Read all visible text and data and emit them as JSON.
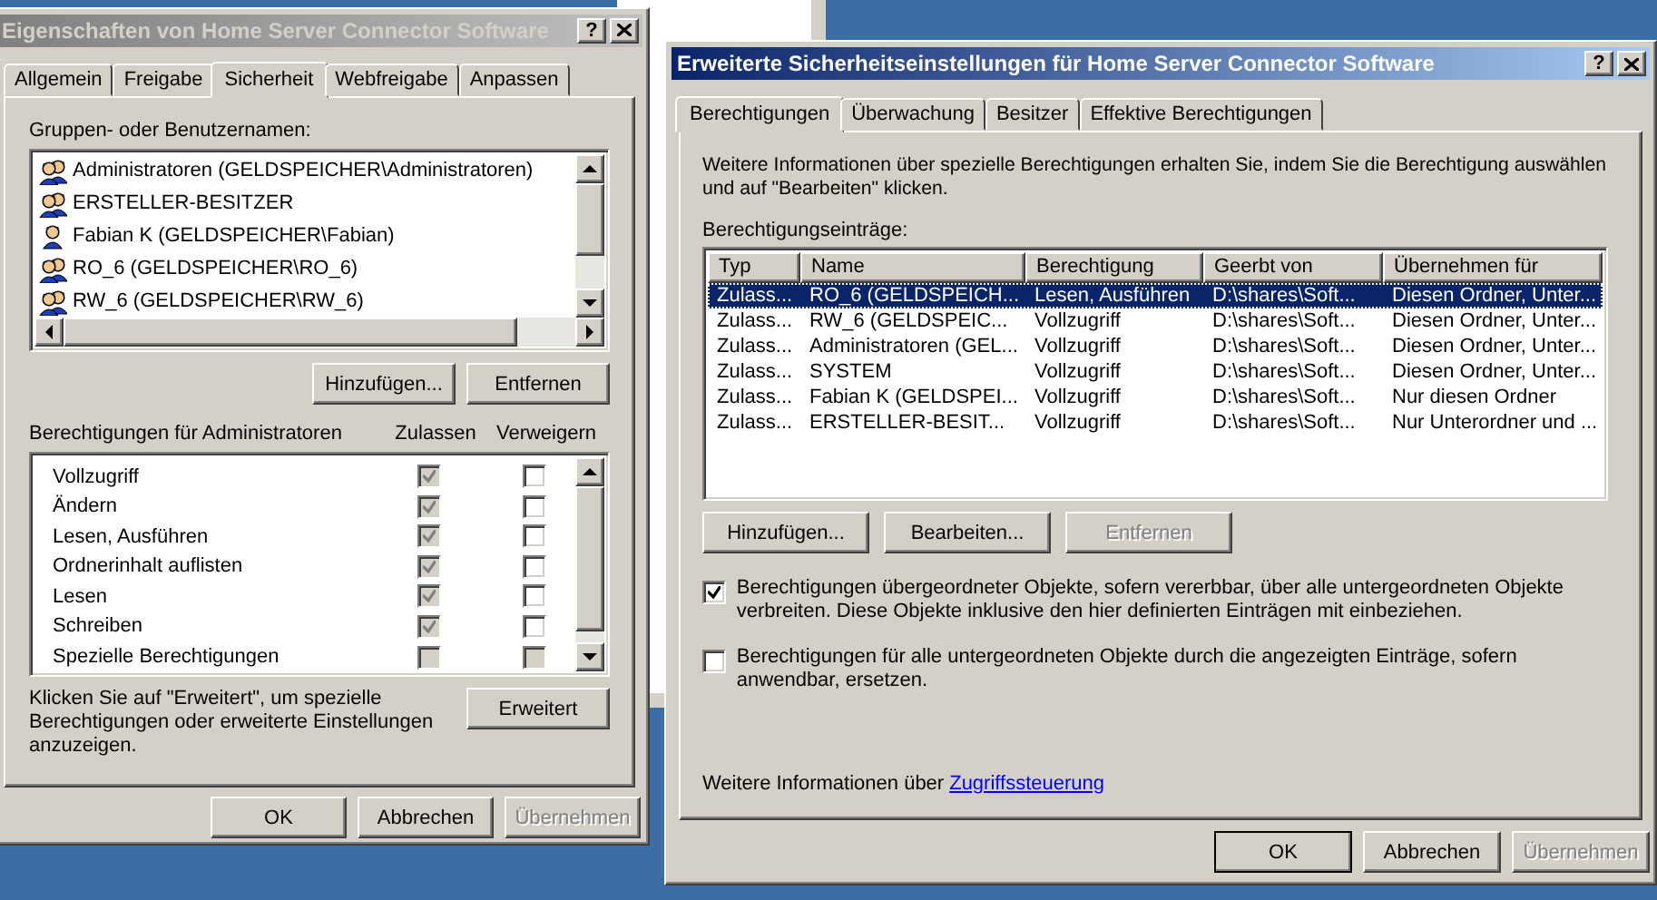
{
  "properties_dialog": {
    "title": "Eigenschaften von Home Server Connector Software",
    "active": false,
    "title_buttons": [
      "?"
    ],
    "tabs": [
      {
        "label": "Allgemein",
        "selected": false
      },
      {
        "label": "Freigabe",
        "selected": false
      },
      {
        "label": "Sicherheit",
        "selected": true
      },
      {
        "label": "Webfreigabe",
        "selected": false
      },
      {
        "label": "Anpassen",
        "selected": false
      }
    ],
    "groups_label": "Gruppen- oder Benutzernamen:",
    "groups": [
      {
        "name": "Administratoren (GELDSPEICHER\\Administratoren)",
        "kind": "group"
      },
      {
        "name": "ERSTELLER-BESITZER",
        "kind": "group"
      },
      {
        "name": "Fabian K (GELDSPEICHER\\Fabian)",
        "kind": "user"
      },
      {
        "name": "RO_6 (GELDSPEICHER\\RO_6)",
        "kind": "group"
      },
      {
        "name": "RW_6 (GELDSPEICHER\\RW_6)",
        "kind": "group"
      }
    ],
    "group_buttons": [
      {
        "label": "Hinzufügen...",
        "disabled": false
      },
      {
        "label": "Entfernen",
        "disabled": false
      }
    ],
    "permissions_label": "Berechtigungen für Administratoren",
    "permission_columns": [
      "Zulassen",
      "Verweigern"
    ],
    "permissions": [
      {
        "name": "Vollzugriff",
        "allow": {
          "checked": true,
          "disabled": true
        },
        "deny": {
          "checked": false,
          "disabled": false
        }
      },
      {
        "name": "Ändern",
        "allow": {
          "checked": true,
          "disabled": true
        },
        "deny": {
          "checked": false,
          "disabled": false
        }
      },
      {
        "name": "Lesen, Ausführen",
        "allow": {
          "checked": true,
          "disabled": true
        },
        "deny": {
          "checked": false,
          "disabled": false
        }
      },
      {
        "name": "Ordnerinhalt auflisten",
        "allow": {
          "checked": true,
          "disabled": true
        },
        "deny": {
          "checked": false,
          "disabled": false
        }
      },
      {
        "name": "Lesen",
        "allow": {
          "checked": true,
          "disabled": true
        },
        "deny": {
          "checked": false,
          "disabled": false
        }
      },
      {
        "name": "Schreiben",
        "allow": {
          "checked": true,
          "disabled": true
        },
        "deny": {
          "checked": false,
          "disabled": false
        }
      },
      {
        "name": "Spezielle Berechtigungen",
        "allow": {
          "checked": false,
          "disabled": true
        },
        "deny": {
          "checked": false,
          "disabled": true
        }
      }
    ],
    "hint": "Klicken Sie auf \"Erweitert\", um spezielle Berechtigungen oder erweiterte Einstellungen anzuzeigen.",
    "advanced_button": {
      "label": "Erweitert",
      "disabled": false
    },
    "buttons": [
      {
        "label": "OK",
        "disabled": false,
        "default": false
      },
      {
        "label": "Abbrechen",
        "disabled": false,
        "default": false
      },
      {
        "label": "Übernehmen",
        "disabled": true,
        "default": false
      }
    ]
  },
  "advanced_dialog": {
    "title": "Erweiterte Sicherheitseinstellungen für Home Server Connector Software",
    "active": true,
    "title_buttons": [
      "?"
    ],
    "tabs": [
      {
        "label": "Berechtigungen",
        "selected": true
      },
      {
        "label": "Überwachung",
        "selected": false
      },
      {
        "label": "Besitzer",
        "selected": false
      },
      {
        "label": "Effektive Berechtigungen",
        "selected": false
      }
    ],
    "intro": "Weitere Informationen über spezielle Berechtigungen erhalten Sie, indem Sie die Berechtigung auswählen und auf \"Bearbeiten\" klicken.",
    "entries_label": "Berechtigungseinträge:",
    "columns": [
      "Typ",
      "Name",
      "Berechtigung",
      "Geerbt von",
      "Übernehmen für"
    ],
    "rows": [
      {
        "cells": [
          "Zulass...",
          "RO_6 (GELDSPEICH...",
          "Lesen, Ausführen",
          "D:\\shares\\Soft...",
          "Diesen Ordner, Unter..."
        ],
        "selected": true
      },
      {
        "cells": [
          "Zulass...",
          "RW_6 (GELDSPEIC...",
          "Vollzugriff",
          "D:\\shares\\Soft...",
          "Diesen Ordner, Unter..."
        ],
        "selected": false
      },
      {
        "cells": [
          "Zulass...",
          "Administratoren (GEL...",
          "Vollzugriff",
          "D:\\shares\\Soft...",
          "Diesen Ordner, Unter..."
        ],
        "selected": false
      },
      {
        "cells": [
          "Zulass...",
          "SYSTEM",
          "Vollzugriff",
          "D:\\shares\\Soft...",
          "Diesen Ordner, Unter..."
        ],
        "selected": false
      },
      {
        "cells": [
          "Zulass...",
          "Fabian K (GELDSPEI...",
          "Vollzugriff",
          "D:\\shares\\Soft...",
          "Nur diesen Ordner"
        ],
        "selected": false
      },
      {
        "cells": [
          "Zulass...",
          "ERSTELLER-BESIT...",
          "Vollzugriff",
          "D:\\shares\\Soft...",
          "Nur Unterordner und ..."
        ],
        "selected": false
      }
    ],
    "entry_buttons": [
      {
        "label": "Hinzufügen...",
        "disabled": false
      },
      {
        "label": "Bearbeiten...",
        "disabled": false
      },
      {
        "label": "Entfernen",
        "disabled": true
      }
    ],
    "options": [
      {
        "label": "Berechtigungen übergeordneter Objekte, sofern vererbbar, über alle untergeordneten Objekte verbreiten. Diese Objekte inklusive den hier definierten Einträgen mit einbeziehen.",
        "checked": true
      },
      {
        "label": "Berechtigungen für alle untergeordneten Objekte durch die angezeigten Einträge, sofern anwendbar, ersetzen.",
        "checked": false
      }
    ],
    "footer_text": "Weitere Informationen über",
    "footer_link": "Zugriffssteuerung",
    "buttons": [
      {
        "label": "OK",
        "disabled": false,
        "default": true
      },
      {
        "label": "Abbrechen",
        "disabled": false,
        "default": false
      },
      {
        "label": "Übernehmen",
        "disabled": true,
        "default": false
      }
    ]
  }
}
